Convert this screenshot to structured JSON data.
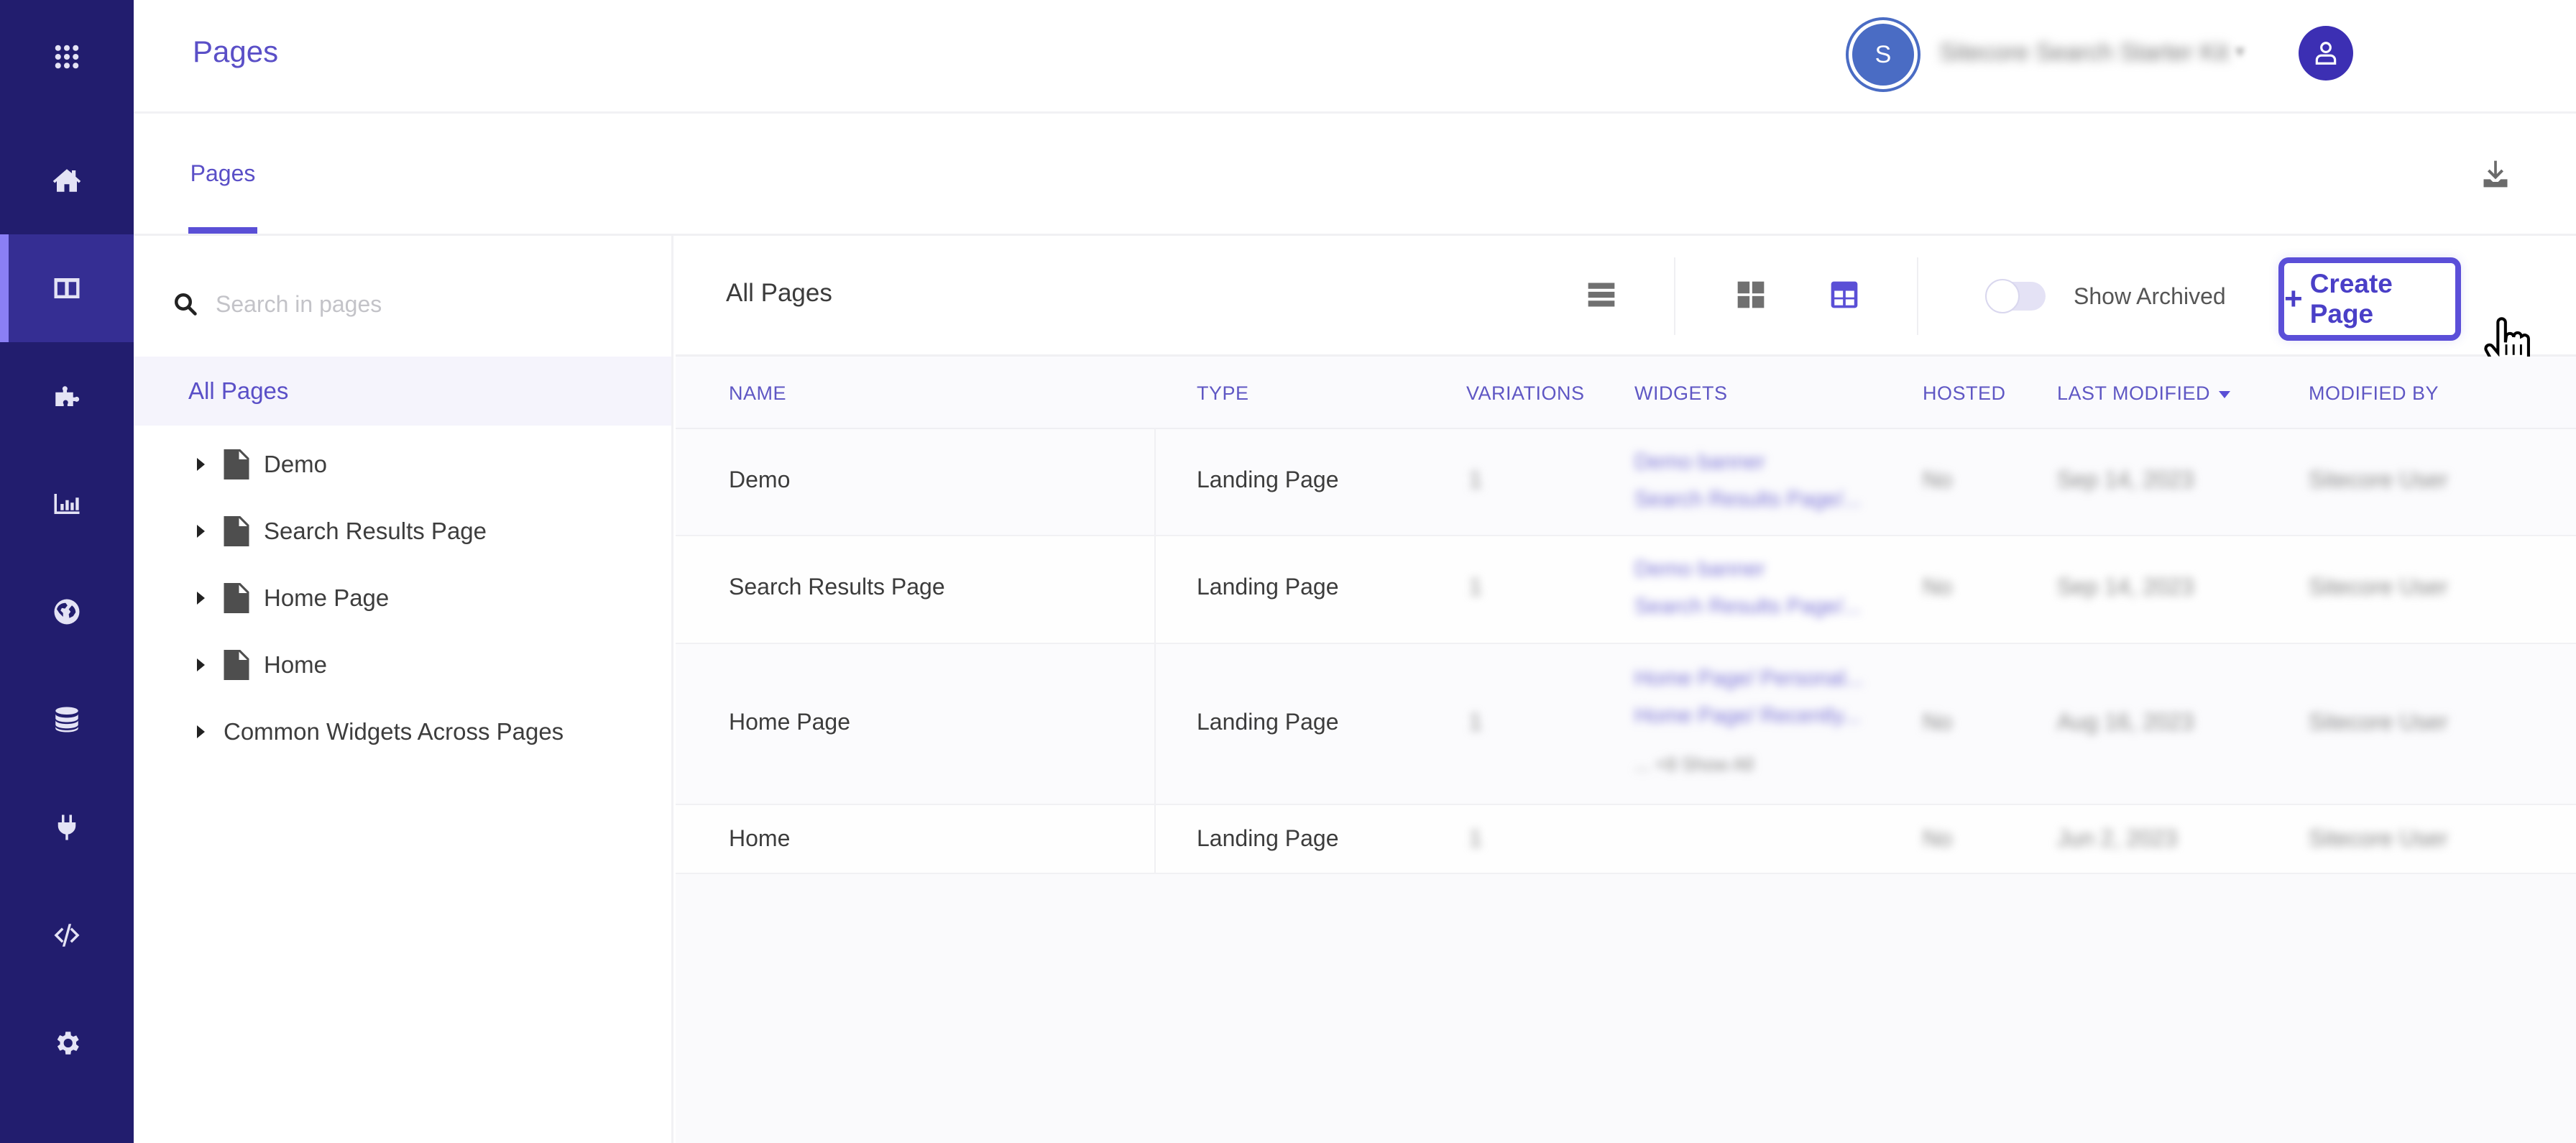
{
  "sidebar": {
    "items": [
      {
        "name": "app-launcher",
        "icon": "grid-icon"
      },
      {
        "name": "home",
        "icon": "home-icon"
      },
      {
        "name": "pages",
        "icon": "layout-icon",
        "active": true
      },
      {
        "name": "widgets",
        "icon": "puzzle-icon"
      },
      {
        "name": "analytics",
        "icon": "bar-chart-icon"
      },
      {
        "name": "global",
        "icon": "globe-icon"
      },
      {
        "name": "sources",
        "icon": "database-icon"
      },
      {
        "name": "integrations",
        "icon": "plug-icon"
      },
      {
        "name": "developer",
        "icon": "code-icon"
      },
      {
        "name": "settings",
        "icon": "gear-icon"
      }
    ]
  },
  "header": {
    "title": "Pages",
    "org_avatar_letter": "S",
    "org_name": "Sitecore Search Starter Kit",
    "user_icon": "user-icon"
  },
  "tabs": [
    {
      "label": "Pages",
      "active": true
    }
  ],
  "left_panel": {
    "search_placeholder": "Search in pages",
    "all_pages_label": "All Pages",
    "tree": [
      {
        "label": "Demo",
        "icon": "file-icon"
      },
      {
        "label": "Search Results Page",
        "icon": "file-icon"
      },
      {
        "label": "Home Page",
        "icon": "file-icon"
      },
      {
        "label": "Home",
        "icon": "file-icon"
      },
      {
        "label": "Common Widgets Across Pages"
      }
    ]
  },
  "toolbar": {
    "title": "All Pages",
    "view_options": [
      "list-view",
      "grid-view",
      "table-view"
    ],
    "active_view": "table-view",
    "show_archived_label": "Show Archived",
    "show_archived": false,
    "create_button_label": "Create Page"
  },
  "table": {
    "columns": [
      "NAME",
      "TYPE",
      "VARIATIONS",
      "WIDGETS",
      "HOSTED",
      "LAST MODIFIED",
      "MODIFIED BY"
    ],
    "sorted_by": "LAST MODIFIED",
    "sort_direction": "desc",
    "rows": [
      {
        "name": "Demo",
        "type": "Landing Page",
        "variations": "1",
        "widgets": [
          "Demo banner",
          "Search Results Page/..."
        ],
        "more": "",
        "hosted": "No",
        "last_modified": "Sep 14, 2023",
        "modified_by": "Sitecore User"
      },
      {
        "name": "Search Results Page",
        "type": "Landing Page",
        "variations": "1",
        "widgets": [
          "Demo banner",
          "Search Results Page/..."
        ],
        "more": "",
        "hosted": "No",
        "last_modified": "Sep 14, 2023",
        "modified_by": "Sitecore User"
      },
      {
        "name": "Home Page",
        "type": "Landing Page",
        "variations": "1",
        "widgets": [
          "Home Page/ Personal...",
          "Home Page/ Recently..."
        ],
        "more": "... +8   Show All",
        "hosted": "No",
        "last_modified": "Aug 16, 2023",
        "modified_by": "Sitecore User"
      },
      {
        "name": "Home",
        "type": "Landing Page",
        "variations": "1",
        "widgets": [],
        "more": "",
        "hosted": "No",
        "last_modified": "Jun 2, 2023",
        "modified_by": "Sitecore User"
      }
    ]
  },
  "colors": {
    "sidebar_bg": "#221d6e",
    "sidebar_active": "#352e93",
    "accent": "#5a4fd6",
    "org_avatar": "#4a6cc4",
    "user_avatar": "#3c2fb3"
  }
}
